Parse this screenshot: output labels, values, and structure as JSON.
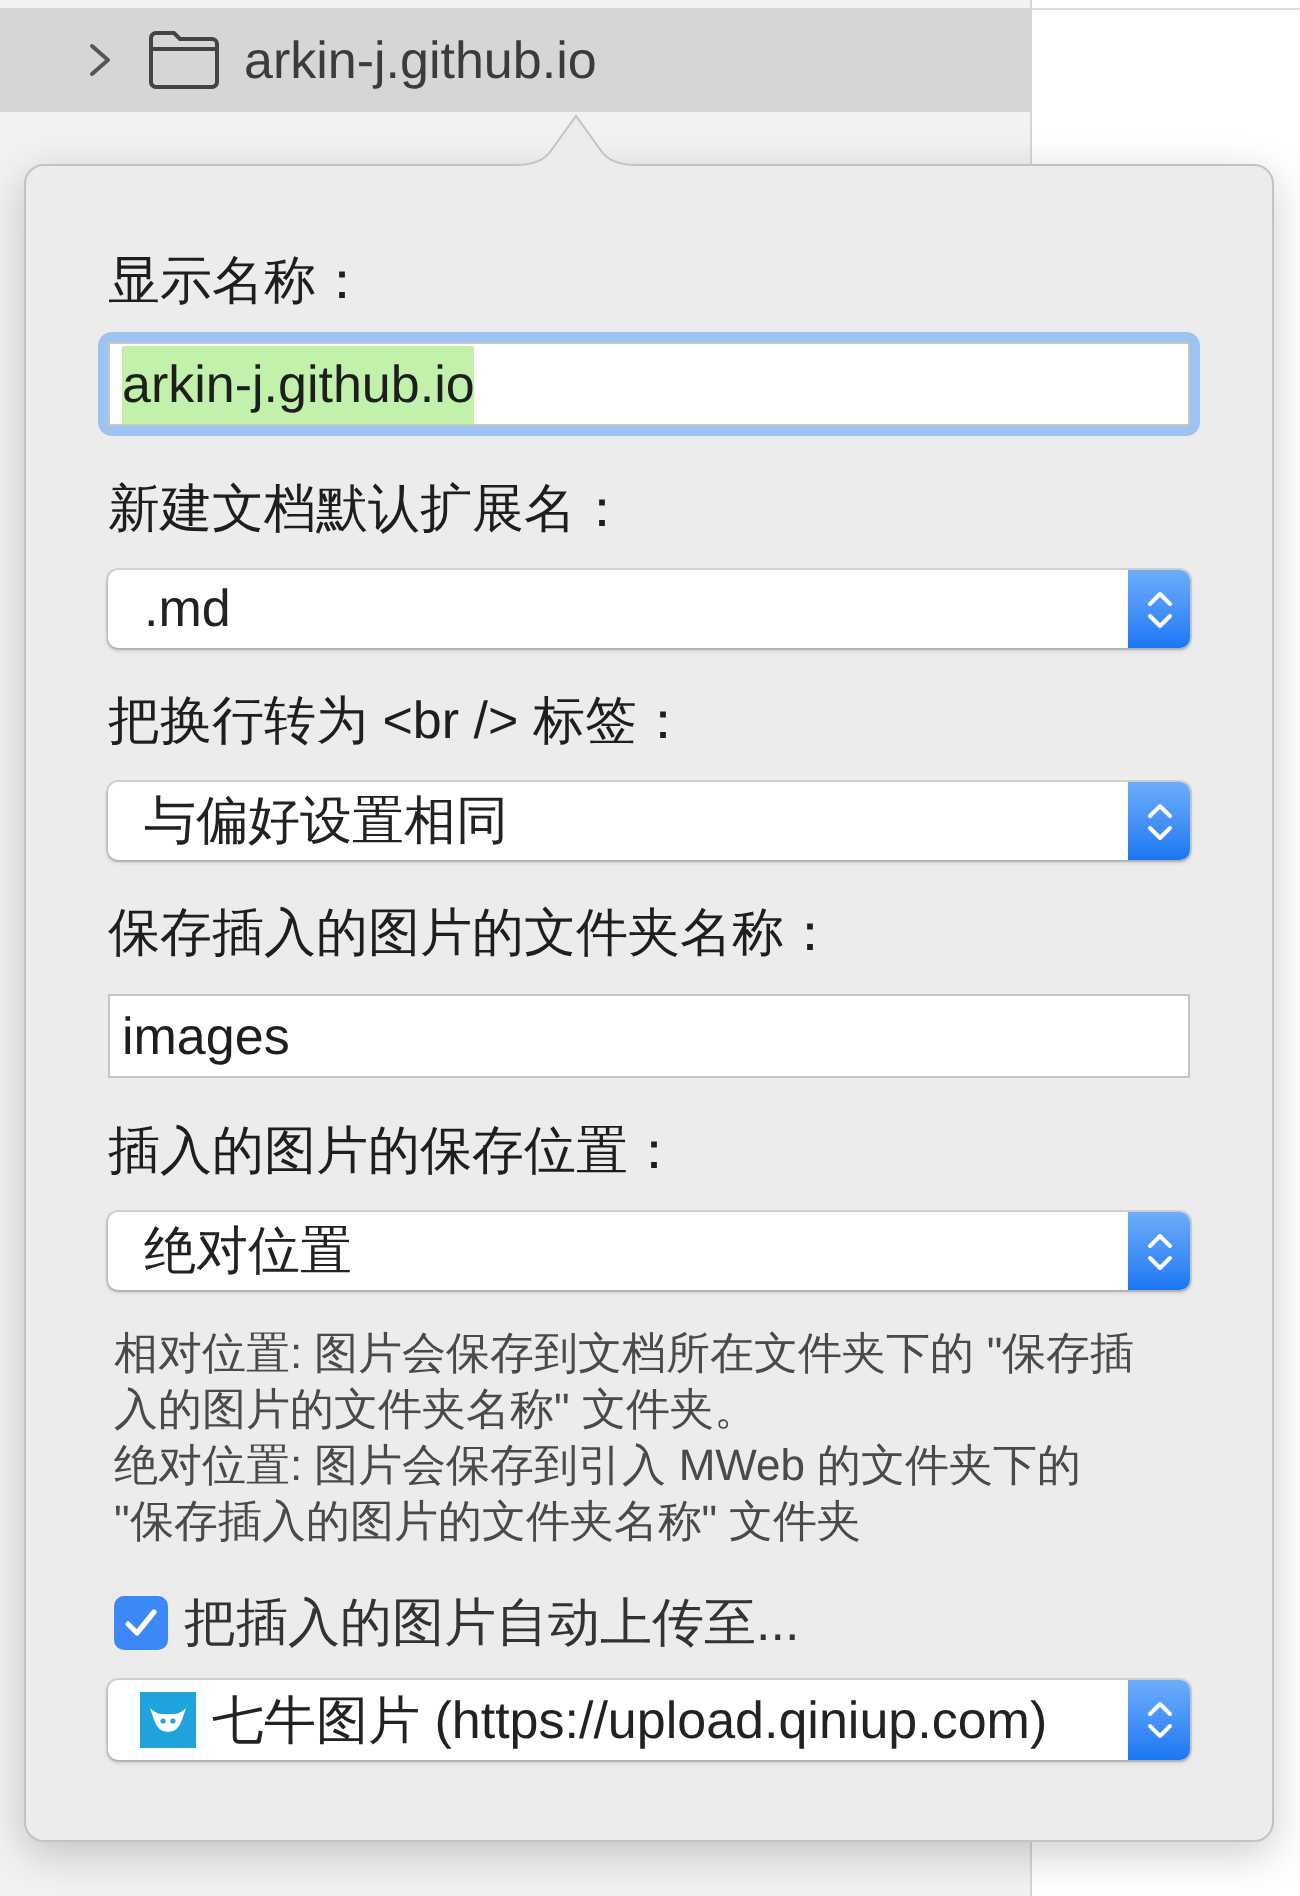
{
  "sidebar": {
    "items": [
      {
        "label": "arkin-j.github.io",
        "selected": true,
        "expanded": false
      }
    ]
  },
  "popover": {
    "rows": [
      {
        "kind": "label",
        "text": "显示名称："
      },
      {
        "kind": "text_field",
        "value": "arkin-j.github.io",
        "focused": true
      },
      {
        "kind": "label",
        "text": "新建文档默认扩展名："
      },
      {
        "kind": "select",
        "value": ".md"
      },
      {
        "kind": "label",
        "text": "把换行转为 <br /> 标签："
      },
      {
        "kind": "select",
        "value": "与偏好设置相同"
      },
      {
        "kind": "label",
        "text": "保存插入的图片的文件夹名称："
      },
      {
        "kind": "text_field",
        "value": "images",
        "focused": false
      },
      {
        "kind": "label",
        "text": "插入的图片的保存位置："
      },
      {
        "kind": "select",
        "value": "绝对位置"
      },
      {
        "kind": "note",
        "text": "相对位置: 图片会保存到文档所在文件夹下的 \"保存插入的图片的文件夹名称\" 文件夹。"
      },
      {
        "kind": "note",
        "text": "绝对位置: 图片会保存到引入 MWeb 的文件夹下的 \"保存插入的图片的文件夹名称\" 文件夹"
      },
      {
        "kind": "checkbox",
        "label": "把插入的图片自动上传至...",
        "checked": true
      },
      {
        "kind": "service_select",
        "value": "七牛图片 (https://upload.qiniup.com)"
      }
    ]
  }
}
